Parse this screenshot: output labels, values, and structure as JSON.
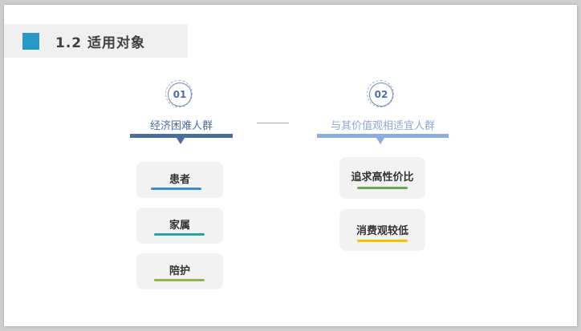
{
  "header": {
    "title": "1.2 适用对象"
  },
  "groups": [
    {
      "number": "01",
      "label": "经济困难人群",
      "label_color": "#4a6d9c",
      "bar_color": "#4a6d9c",
      "items": [
        {
          "label": "患者",
          "underline_color": "#3a8fd0"
        },
        {
          "label": "家属",
          "underline_color": "#2aa0ae"
        },
        {
          "label": "陪护",
          "underline_color": "#8db54a"
        }
      ]
    },
    {
      "number": "02",
      "label": "与其价值观相适宜人群",
      "label_color": "#8aa8d8",
      "bar_color": "#8aaee0",
      "items": [
        {
          "label": "追求高性价比",
          "underline_color": "#6aa84f"
        },
        {
          "label": "消费观较低",
          "underline_color": "#f2c200"
        }
      ]
    }
  ]
}
